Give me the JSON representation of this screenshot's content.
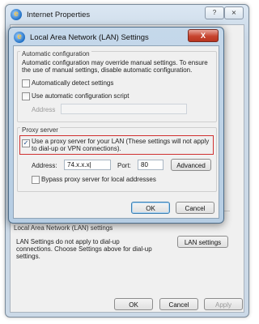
{
  "outer": {
    "title": "Internet Properties",
    "help_label": "?",
    "close_label": "⨯",
    "lan_group_label": "Local Area Network (LAN) settings",
    "lan_description": "LAN Settings do not apply to dial-up connections. Choose Settings above for dial-up settings.",
    "lan_settings_button": "LAN settings",
    "ok_button": "OK",
    "cancel_button": "Cancel",
    "apply_button": "Apply"
  },
  "dialog": {
    "title": "Local Area Network (LAN) Settings",
    "close_label": "X",
    "auto_config": {
      "group_label": "Automatic configuration",
      "description": "Automatic configuration may override manual settings.  To ensure the use of manual settings, disable automatic configuration.",
      "auto_detect_label": "Automatically detect settings",
      "auto_detect_checked": false,
      "script_label": "Use automatic configuration script",
      "script_checked": false,
      "address_label": "Address",
      "address_value": ""
    },
    "proxy": {
      "group_label": "Proxy server",
      "use_proxy_label": "Use a proxy server for your LAN (These settings will not apply to dial-up or VPN connections).",
      "use_proxy_checked": true,
      "check_mark": "✓",
      "address_label": "Address:",
      "address_value": "74.x.x.x|",
      "port_label": "Port:",
      "port_value": "80",
      "advanced_button": "Advanced",
      "bypass_label": "Bypass proxy server for local addresses",
      "bypass_checked": false
    },
    "ok_button": "OK",
    "cancel_button": "Cancel"
  },
  "colors": {
    "highlight": "#d03030",
    "close_button": "#c7442f"
  }
}
